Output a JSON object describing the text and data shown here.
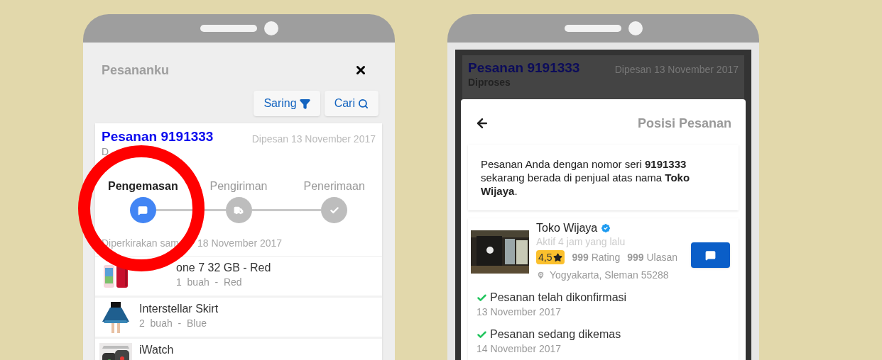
{
  "order_list": {
    "title": "Pesananku",
    "buttons": [
      {
        "label": "Saring"
      },
      {
        "label": "Cari"
      }
    ],
    "order": {
      "title": "Pesanan 9191333",
      "status": "D",
      "date": "Dipesan 13 November 2017",
      "steps": [
        {
          "label": "Pengemasan",
          "selected": true
        },
        {
          "label": "Pengiriman",
          "selected": false
        },
        {
          "label": "Penerimaan",
          "selected": false
        }
      ],
      "estimate": [
        "Diperkirakan sam",
        "18 November 2017"
      ],
      "items": [
        {
          "name": "one 7 32 GB - Red",
          "detail": "1  buah  -  Red"
        },
        {
          "name": "Interstellar Skirt",
          "detail": "2  buah  -  Blue"
        },
        {
          "name": "iWatch"
        }
      ]
    }
  },
  "order_position": {
    "background_order": {
      "title": "Pesanan 9191333",
      "status": "Diproses",
      "date": "Dipesan 13 November 2017"
    },
    "title": "Posisi Pesanan",
    "message": "Pesanan Anda dengan nomor seri **9191333** sekarang berada di penjual atas nama **Toko Wijaya**.",
    "store": {
      "name": "Toko Wijaya",
      "active": "Aktif 4 jam yang lalu",
      "rating": "4,5",
      "ratings": "**999** Rating",
      "reviews": "**999** Ulasan",
      "location": "Yogyakarta, Sleman 55288"
    },
    "timeline": [
      {
        "text": "Pesanan telah dikonfirmasi",
        "date": "13 November 2017"
      },
      {
        "text": "Pesanan sedang dikemas",
        "date": "14 November 2017"
      }
    ]
  }
}
